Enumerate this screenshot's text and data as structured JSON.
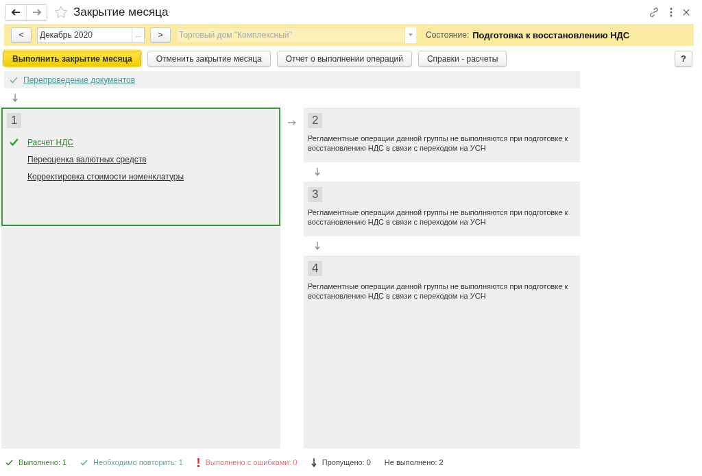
{
  "window": {
    "title": "Закрытие месяца"
  },
  "period": {
    "prev": "<",
    "value": "Декабрь 2020",
    "choose": "...",
    "next": ">"
  },
  "organization": {
    "placeholder": "Торговый дом \"Комплексный\""
  },
  "state": {
    "label": "Состояние:",
    "value": "Подготовка к восстановлению НДС"
  },
  "actions": [
    {
      "label": "Выполнить закрытие месяца",
      "primary": true
    },
    {
      "label": "Отменить закрытие месяца",
      "primary": false
    },
    {
      "label": "Отчет о выполнении операций",
      "primary": false
    },
    {
      "label": "Справки - расчеты",
      "primary": false
    }
  ],
  "help": "?",
  "preliminary": {
    "label": "Перепроведение документов",
    "kind": "repeat"
  },
  "groups": [
    {
      "number": "1",
      "selected": true,
      "operations": [
        {
          "label": "Расчет НДС",
          "kind": "done"
        },
        {
          "label": "Переоценка валютных средств",
          "kind": "plain"
        },
        {
          "label": "Корректировка стоимости номенклатуры",
          "kind": "plain"
        }
      ]
    },
    {
      "number": "2",
      "selected": false,
      "note": "Регламентные операции данной группы не выполняются при подготовке к восстановлению НДС в связи с переходом на УСН"
    },
    {
      "number": "3",
      "selected": false,
      "note": "Регламентные операции данной группы не выполняются при подготовке к восстановлению НДС в связи с переходом на УСН"
    },
    {
      "number": "4",
      "selected": false,
      "note": "Регламентные операции данной группы не выполняются при подготовке к восстановлению НДС в связи с переходом на УСН"
    }
  ],
  "legend": [
    {
      "kind": "done",
      "text": "Выполнено: 1"
    },
    {
      "kind": "repeat",
      "text": "Необходимо повторить: 1"
    },
    {
      "kind": "error",
      "text": "Выполнено с ошибками: 0"
    },
    {
      "kind": "skipped",
      "text": "Пропущено: 0"
    },
    {
      "kind": "pending",
      "text": "Не выполнено: 2"
    }
  ]
}
